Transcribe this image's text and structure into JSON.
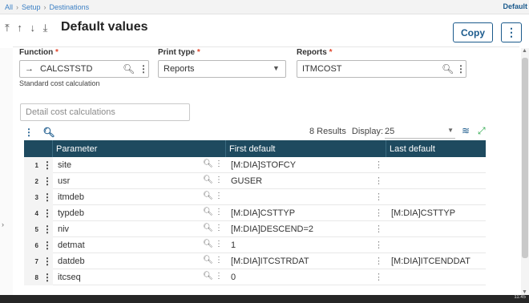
{
  "breadcrumb": {
    "items": [
      "All",
      "Setup",
      "Destinations"
    ],
    "right_label": "Default"
  },
  "header": {
    "arrows": "⤒ ↑ ↓ ⤓",
    "title": "Default values",
    "copy_label": "Copy",
    "more_label": "⋮"
  },
  "form": {
    "function": {
      "label": "Function",
      "value": "CALCSTSTD",
      "arrow": "→",
      "description": "Standard cost calculation"
    },
    "print_type": {
      "label": "Print type",
      "value": "Reports"
    },
    "reports": {
      "label": "Reports",
      "value": "ITMCOST"
    },
    "required_mark": "*"
  },
  "detail": {
    "placeholder": "Detail cost calculations"
  },
  "grid_toolbar": {
    "results_text": "8 Results",
    "display_label": "Display:",
    "display_value": "25"
  },
  "grid": {
    "columns": [
      "Parameter",
      "First default",
      "Last default"
    ],
    "rows": [
      {
        "num": "1",
        "param": "site",
        "first": "[M:DIA]STOFCY",
        "last": ""
      },
      {
        "num": "2",
        "param": "usr",
        "first": "GUSER",
        "last": ""
      },
      {
        "num": "3",
        "param": "itmdeb",
        "first": "",
        "last": ""
      },
      {
        "num": "4",
        "param": "typdeb",
        "first": "[M:DIA]CSTTYP",
        "last": "[M:DIA]CSTTYP"
      },
      {
        "num": "5",
        "param": "niv",
        "first": "[M:DIA]DESCEND=2",
        "last": ""
      },
      {
        "num": "6",
        "param": "detmat",
        "first": "1",
        "last": ""
      },
      {
        "num": "7",
        "param": "datdeb",
        "first": "[M:DIA]ITCSTRDAT",
        "last": "[M:DIA]ITCENDDAT"
      },
      {
        "num": "8",
        "param": "itcseq",
        "first": "0",
        "last": ""
      }
    ]
  },
  "footer": {
    "text": "11:45"
  },
  "colors": {
    "accent": "#1b5a8c",
    "grid_header": "#1e4a5f",
    "required": "#e0452b"
  }
}
